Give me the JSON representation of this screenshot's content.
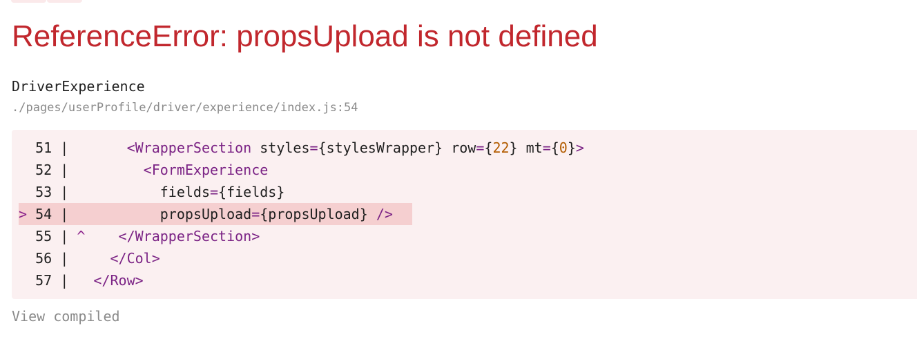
{
  "error": {
    "title": "ReferenceError: propsUpload is not defined"
  },
  "location": {
    "component": "DriverExperience",
    "file": "./pages/userProfile/driver/experience/index.js:54"
  },
  "code_frame": {
    "lines": [
      {
        "marker": "  ",
        "number": "51",
        "caret": " ",
        "indent": "    ",
        "tokens": [
          {
            "t": "<WrapperSection",
            "k": "tag"
          },
          {
            "t": " styles",
            "k": "plain"
          },
          {
            "t": "=",
            "k": "eq"
          },
          {
            "t": "{stylesWrapper}",
            "k": "plain"
          },
          {
            "t": " row",
            "k": "plain"
          },
          {
            "t": "=",
            "k": "eq"
          },
          {
            "t": "{",
            "k": "plain"
          },
          {
            "t": "22",
            "k": "num"
          },
          {
            "t": "}",
            "k": "plain"
          },
          {
            "t": " mt",
            "k": "plain"
          },
          {
            "t": "=",
            "k": "eq"
          },
          {
            "t": "{",
            "k": "plain"
          },
          {
            "t": "0",
            "k": "num"
          },
          {
            "t": "}",
            "k": "plain"
          },
          {
            "t": ">",
            "k": "tag"
          }
        ]
      },
      {
        "marker": "  ",
        "number": "52",
        "caret": " ",
        "indent": "      ",
        "tokens": [
          {
            "t": "<FormExperience",
            "k": "tag"
          }
        ]
      },
      {
        "marker": "  ",
        "number": "53",
        "caret": " ",
        "indent": "        ",
        "tokens": [
          {
            "t": "fields",
            "k": "plain"
          },
          {
            "t": "=",
            "k": "eq"
          },
          {
            "t": "{fields}",
            "k": "plain"
          }
        ]
      },
      {
        "marker": "> ",
        "number": "54",
        "caret": " ",
        "indent": "        ",
        "highlight": true,
        "tokens": [
          {
            "t": "propsUpload",
            "k": "plain"
          },
          {
            "t": "=",
            "k": "eq"
          },
          {
            "t": "{propsUpload}",
            "k": "plain"
          },
          {
            "t": " />",
            "k": "tag"
          }
        ]
      },
      {
        "marker": "  ",
        "number": "55",
        "caret": "^",
        "indent": "   ",
        "tokens": [
          {
            "t": "</WrapperSection>",
            "k": "tag"
          }
        ]
      },
      {
        "marker": "  ",
        "number": "56",
        "caret": " ",
        "indent": "  ",
        "tokens": [
          {
            "t": "</Col>",
            "k": "tag"
          }
        ]
      },
      {
        "marker": "  ",
        "number": "57",
        "caret": " ",
        "indent": "",
        "tokens": [
          {
            "t": "</Row>",
            "k": "tag"
          }
        ]
      }
    ]
  },
  "actions": {
    "view_compiled": "View compiled"
  },
  "colors": {
    "error_title": "#c1272d",
    "code_background": "#fbf0f1",
    "highlight_line": "#f5cfd0",
    "tag": "#7b2385",
    "number": "#b35c00",
    "muted": "#8a8a8a"
  }
}
